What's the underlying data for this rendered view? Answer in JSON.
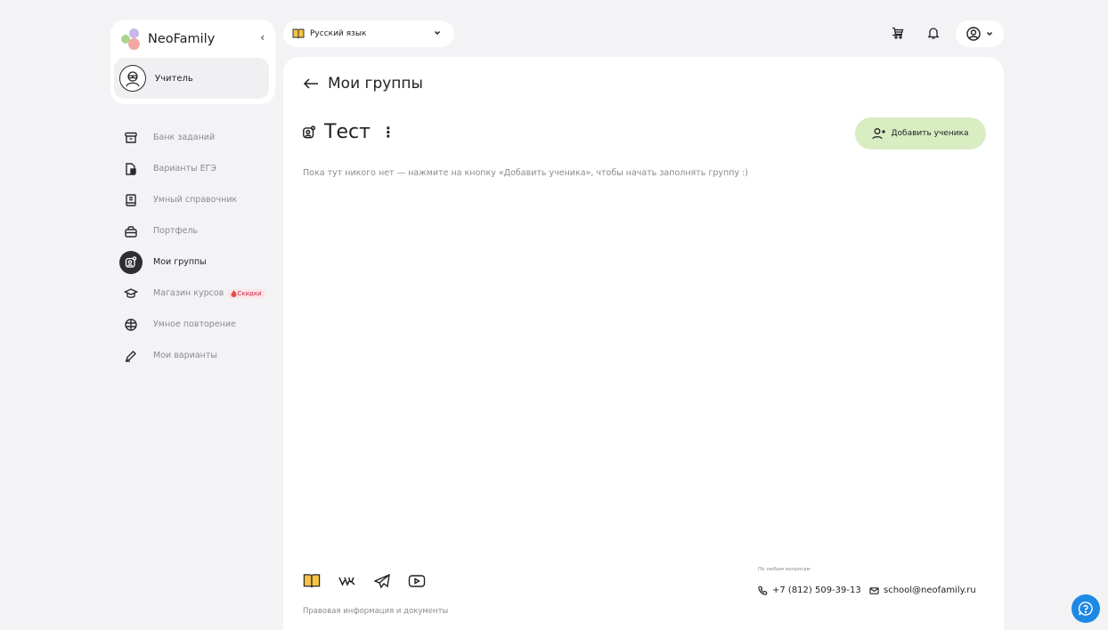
{
  "brand": {
    "name": "NeoFamily",
    "collapse_glyph": "‹"
  },
  "role": {
    "label": "Учитель"
  },
  "sidebar": {
    "items": [
      {
        "label": "Банк заданий",
        "icon": "archive-icon",
        "active": false
      },
      {
        "label": "Варианты ЕГЭ",
        "icon": "document-icon",
        "active": false
      },
      {
        "label": "Умный справочник",
        "icon": "book-icon",
        "active": false
      },
      {
        "label": "Портфель",
        "icon": "briefcase-icon",
        "active": false
      },
      {
        "label": "Мои группы",
        "icon": "group-icon",
        "active": true
      },
      {
        "label": "Магазин курсов",
        "icon": "graduation-cap-icon",
        "active": false,
        "badge": "Скидки"
      },
      {
        "label": "Умное повторение",
        "icon": "brain-icon",
        "active": false
      },
      {
        "label": "Мои варианты",
        "icon": "pencil-icon",
        "active": false
      }
    ]
  },
  "subject": {
    "label": "Русский язык",
    "icon": "book-open-icon"
  },
  "header": {
    "icons": [
      "cart-icon",
      "bell-icon",
      "user-circle-icon"
    ]
  },
  "main": {
    "title": "Мои группы",
    "group_name": "Тест",
    "group_menu_glyph": "⋮",
    "add_button_label": "Добавить ученика",
    "empty_message": "Пока тут никого нет — нажмите на кнопку «Добавить ученика», чтобы начать заполнять группу :)"
  },
  "footer": {
    "social_icons": [
      "book-icon",
      "vk-icon",
      "telegram-icon",
      "youtube-icon"
    ],
    "legal_link": "Правовая информация и документы",
    "contact_caption": "По любым вопросам",
    "phone": "+7 (812) 509-39-13",
    "email": "school@neofamily.ru"
  },
  "colors": {
    "accent_green": "#d9edc3",
    "active_dark": "#2d2d33",
    "help_blue": "#1e88e5",
    "sale_red": "#c02a43"
  }
}
